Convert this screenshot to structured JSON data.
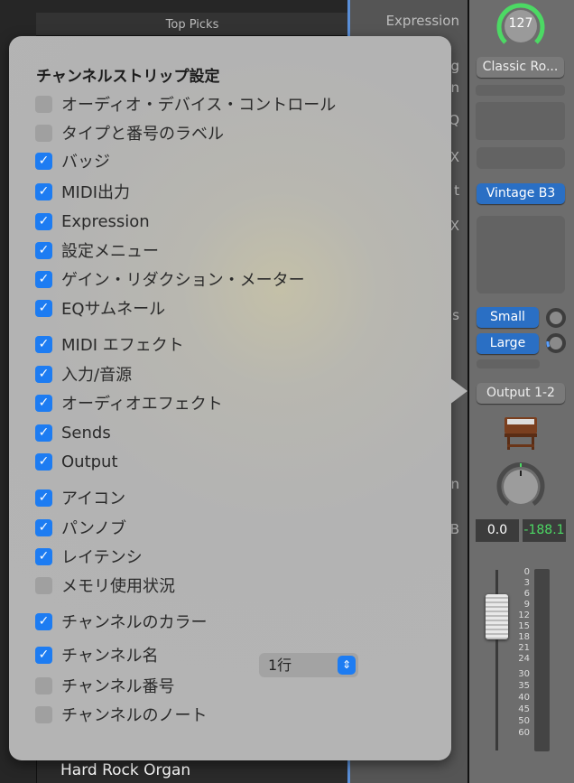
{
  "background": {
    "top_picks": "Top Picks",
    "track_name": "Hard Rock Organ"
  },
  "middle_labels": [
    "Expression",
    "g",
    "n",
    "Q",
    "X",
    "t",
    "X",
    "s",
    "n",
    "B"
  ],
  "strip": {
    "expression_value": "127",
    "setting_button": "Classic Ro...",
    "instrument_button": "Vintage B3",
    "send_1": "Small",
    "send_2": "Large",
    "output_button": "Output 1-2",
    "volume_value": "0.0",
    "peak_value": "-188.1",
    "scale": [
      "0",
      "3",
      "6",
      "9",
      "12",
      "15",
      "18",
      "21",
      "24",
      "30",
      "35",
      "40",
      "45",
      "50",
      "60"
    ],
    "colors": {
      "accent": "#2a6fc4",
      "meter_green": "#4cd964"
    }
  },
  "popover": {
    "title": "チャンネルストリップ設定",
    "items": [
      {
        "label": "オーディオ・デバイス・コントロール",
        "checked": false
      },
      {
        "label": "タイプと番号のラベル",
        "checked": false
      },
      {
        "label": "バッジ",
        "checked": true
      },
      {
        "label": "MIDI出力",
        "checked": true
      },
      {
        "label": "Expression",
        "checked": true
      },
      {
        "label": "設定メニュー",
        "checked": true
      },
      {
        "label": "ゲイン・リダクション・メーター",
        "checked": true
      },
      {
        "label": "EQサムネール",
        "checked": true
      },
      {
        "label": "MIDI エフェクト",
        "checked": true
      },
      {
        "label": "入力/音源",
        "checked": true
      },
      {
        "label": "オーディオエフェクト",
        "checked": true
      },
      {
        "label": "Sends",
        "checked": true
      },
      {
        "label": "Output",
        "checked": true
      },
      {
        "label": "アイコン",
        "checked": true
      },
      {
        "label": "パンノブ",
        "checked": true
      },
      {
        "label": "レイテンシ",
        "checked": true
      },
      {
        "label": "メモリ使用状況",
        "checked": false
      },
      {
        "label": "チャンネルのカラー",
        "checked": true
      },
      {
        "label": "チャンネル名",
        "checked": true
      },
      {
        "label": "チャンネル番号",
        "checked": false
      },
      {
        "label": "チャンネルのノート",
        "checked": false
      }
    ],
    "name_lines_select": "1行"
  }
}
